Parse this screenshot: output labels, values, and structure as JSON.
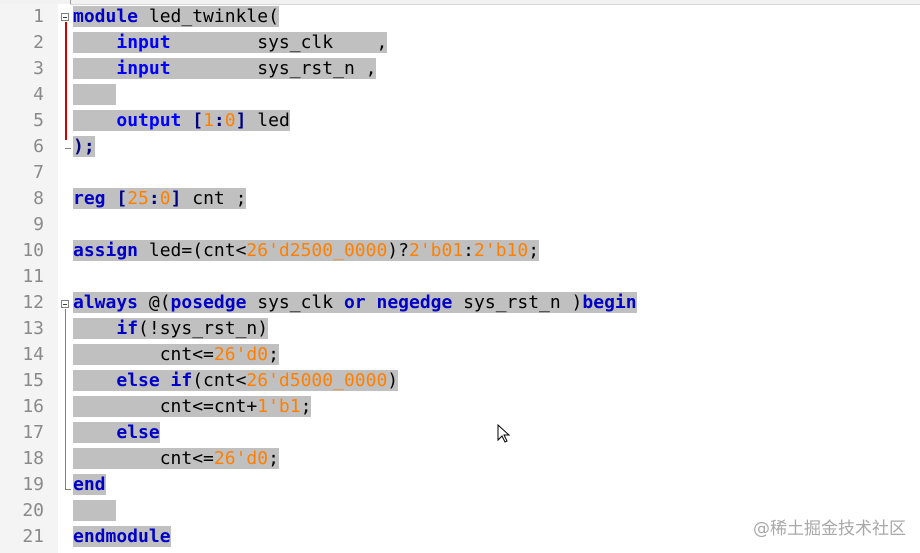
{
  "editor": {
    "lines": [
      {
        "n": "1",
        "parts": [
          [
            "module",
            "kw2"
          ],
          [
            " led_twinkle(",
            ""
          ]
        ]
      },
      {
        "n": "2",
        "parts": [
          [
            "    ",
            ""
          ],
          [
            "input",
            "kw"
          ],
          [
            "        sys_clk    ,",
            ""
          ]
        ]
      },
      {
        "n": "3",
        "parts": [
          [
            "    ",
            ""
          ],
          [
            "input",
            "kw"
          ],
          [
            "        sys_rst_n ,",
            ""
          ]
        ]
      },
      {
        "n": "4",
        "parts": [
          [
            "    ",
            ""
          ]
        ]
      },
      {
        "n": "5",
        "parts": [
          [
            "    ",
            ""
          ],
          [
            "output",
            "kw"
          ],
          [
            " ",
            ""
          ],
          [
            "[",
            "op"
          ],
          [
            "1",
            "num"
          ],
          [
            ":",
            "op"
          ],
          [
            "0",
            "num"
          ],
          [
            "]",
            "op"
          ],
          [
            " led",
            ""
          ]
        ]
      },
      {
        "n": "6",
        "parts": [
          [
            ");",
            "op"
          ]
        ]
      },
      {
        "n": "7",
        "parts": []
      },
      {
        "n": "8",
        "parts": [
          [
            "reg",
            "kw2"
          ],
          [
            " ",
            ""
          ],
          [
            "[",
            "op"
          ],
          [
            "25",
            "num"
          ],
          [
            ":",
            "op"
          ],
          [
            "0",
            "num"
          ],
          [
            "]",
            "op"
          ],
          [
            " cnt ;",
            ""
          ]
        ]
      },
      {
        "n": "9",
        "parts": []
      },
      {
        "n": "10",
        "parts": [
          [
            "assign",
            "kw2"
          ],
          [
            " led=(cnt<",
            ""
          ],
          [
            "26'd2500_0000",
            "num"
          ],
          [
            ")?",
            ""
          ],
          [
            "2'b01",
            "num"
          ],
          [
            ":",
            ""
          ],
          [
            "2'b10",
            "num"
          ],
          [
            ";",
            ""
          ]
        ]
      },
      {
        "n": "11",
        "parts": []
      },
      {
        "n": "12",
        "parts": [
          [
            "always",
            "kw2"
          ],
          [
            " @(",
            ""
          ],
          [
            "posedge",
            "kw2"
          ],
          [
            " sys_clk ",
            ""
          ],
          [
            "or",
            "kw2"
          ],
          [
            " ",
            ""
          ],
          [
            "negedge",
            "kw2"
          ],
          [
            " sys_rst_n )",
            ""
          ],
          [
            "begin",
            "kw2"
          ]
        ]
      },
      {
        "n": "13",
        "parts": [
          [
            "    ",
            ""
          ],
          [
            "if",
            "kw2"
          ],
          [
            "(!sys_rst_n)",
            ""
          ]
        ]
      },
      {
        "n": "14",
        "parts": [
          [
            "        cnt<=",
            ""
          ],
          [
            "26'd0",
            "num"
          ],
          [
            ";",
            ""
          ]
        ]
      },
      {
        "n": "15",
        "parts": [
          [
            "    ",
            ""
          ],
          [
            "else if",
            "kw2"
          ],
          [
            "(cnt<",
            ""
          ],
          [
            "26'd5000_0000",
            "num"
          ],
          [
            ")",
            ""
          ]
        ]
      },
      {
        "n": "16",
        "parts": [
          [
            "        cnt<=cnt+",
            ""
          ],
          [
            "1'b1",
            "num"
          ],
          [
            ";",
            ""
          ]
        ]
      },
      {
        "n": "17",
        "parts": [
          [
            "    ",
            ""
          ],
          [
            "else",
            "kw2"
          ]
        ]
      },
      {
        "n": "18",
        "parts": [
          [
            "        cnt<=",
            ""
          ],
          [
            "26'd0",
            "num"
          ],
          [
            ";",
            ""
          ]
        ]
      },
      {
        "n": "19",
        "parts": [
          [
            "end",
            "kw2"
          ]
        ]
      },
      {
        "n": "20",
        "parts": [
          [
            "    ",
            ""
          ]
        ]
      },
      {
        "n": "21",
        "parts": [
          [
            "endmodule",
            "kw2"
          ]
        ]
      }
    ]
  },
  "watermark": "@稀土掘金技术社区",
  "colors": {
    "keyword": "#0000ff",
    "number": "#ff8000",
    "selection": "#c0c0c0",
    "fold_marker": "#d00000",
    "line_number": "#8a8a8a"
  },
  "icons": {
    "mouse_cursor": "mouse-pointer-icon",
    "fold_toggle": "fold-minus-icon"
  }
}
